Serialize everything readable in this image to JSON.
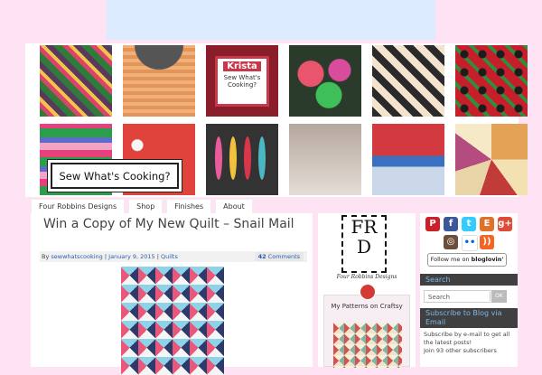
{
  "site": {
    "logo_text": "Sew What's Cooking?",
    "krista_name": "Krista",
    "krista_line1": "Sew What's",
    "krista_line2": "Cooking?"
  },
  "nav": {
    "items": [
      {
        "label": "Four Robbins Designs"
      },
      {
        "label": "Shop"
      },
      {
        "label": "Finishes"
      },
      {
        "label": "About"
      }
    ]
  },
  "post": {
    "title": "Win a Copy of My New Quilt – Snail Mail",
    "meta_by": "By",
    "author": "sewwhatscooking",
    "separator": "|",
    "date": "January 9, 2015",
    "category": "Quilts",
    "comments_count": "42",
    "comments_label": "Comments"
  },
  "sidebar_middle": {
    "frd_top": "FR",
    "frd_bottom": "D",
    "frd_caption": "Four Robbins Designs",
    "craftsy_title": "My Patterns on Craftsy"
  },
  "sidebar_right": {
    "social_icons": [
      {
        "name": "pinterest-icon",
        "glyph": "P",
        "color": "#cb2027"
      },
      {
        "name": "facebook-icon",
        "glyph": "f",
        "color": "#3b5998"
      },
      {
        "name": "twitter-icon",
        "glyph": "t",
        "color": "#33ccff"
      },
      {
        "name": "etsy-icon",
        "glyph": "E",
        "color": "#e0712b"
      },
      {
        "name": "googleplus-icon",
        "glyph": "g+",
        "color": "#dd4b39"
      },
      {
        "name": "instagram-icon",
        "glyph": "◎",
        "color": "#6b4f3a"
      },
      {
        "name": "flickr-icon",
        "glyph": "••",
        "color": "#ffffff"
      },
      {
        "name": "rss-icon",
        "glyph": "))",
        "color": "#f26522"
      }
    ],
    "bloglovin_prefix": "Follow me on",
    "bloglovin_brand": "bloglovin'",
    "search_heading": "Search",
    "search_placeholder": "Search",
    "search_button": "OK",
    "subscribe_heading": "Subscribe to Blog via Email",
    "subscribe_text": "Subscribe by e-mail to get all the latest posts!",
    "subscribers_text": "Join 93 other subscribers"
  }
}
